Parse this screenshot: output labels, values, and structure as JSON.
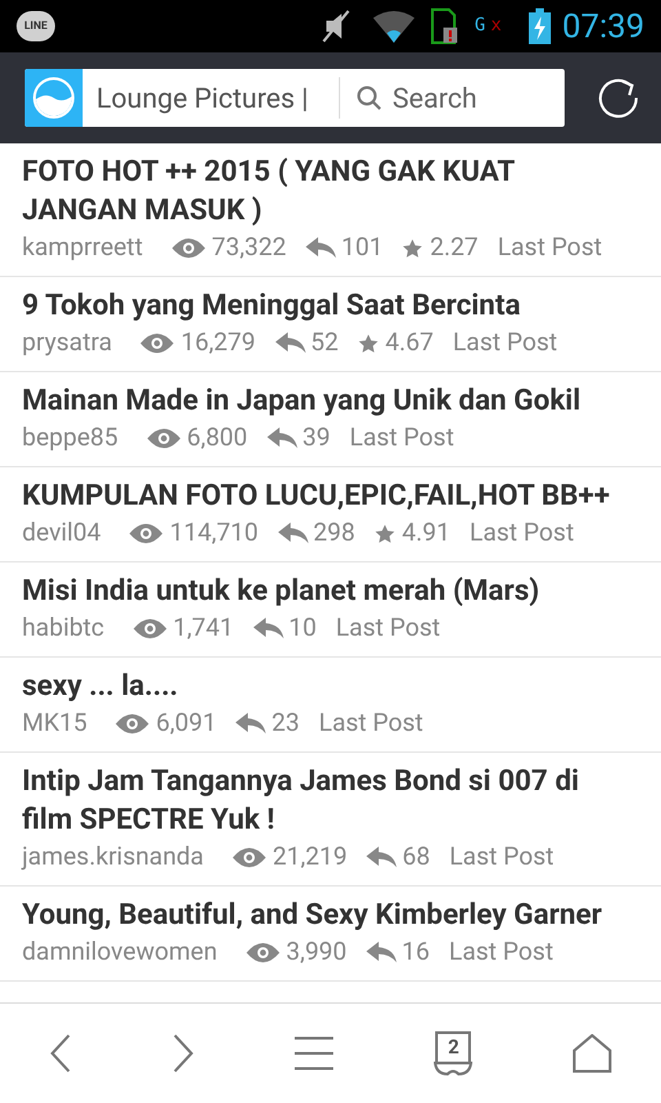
{
  "status_bar": {
    "app_badge": "LINE",
    "network": "G",
    "network_error": "x",
    "time": "07:39"
  },
  "address_bar": {
    "url": "Lounge Pictures |",
    "search_placeholder": "Search"
  },
  "threads": [
    {
      "title": "FOTO HOT ++ 2015 ( YANG GAK KUAT JANGAN MASUK )",
      "author": "kamprreett",
      "views": "73,322",
      "replies": "101",
      "rating": "2.27",
      "last_post": "Last Post"
    },
    {
      "title": "9 Tokoh yang Meninggal Saat Bercinta",
      "author": "prysatra",
      "views": "16,279",
      "replies": "52",
      "rating": "4.67",
      "last_post": "Last Post"
    },
    {
      "title": "Mainan Made in Japan yang Unik dan Gokil",
      "author": "beppe85",
      "views": "6,800",
      "replies": "39",
      "last_post": "Last Post"
    },
    {
      "title": "KUMPULAN FOTO LUCU,EPIC,FAIL,HOT BB++",
      "author": "devil04",
      "views": "114,710",
      "replies": "298",
      "rating": "4.91",
      "last_post": "Last Post"
    },
    {
      "title": "Misi India untuk ke planet merah (Mars)",
      "author": "habibtc",
      "views": "1,741",
      "replies": "10",
      "last_post": "Last Post"
    },
    {
      "title": "sexy ... la....",
      "author": "MK15",
      "views": "6,091",
      "replies": "23",
      "last_post": "Last Post"
    },
    {
      "title": "Intip Jam Tangannya James Bond si 007 di film SPECTRE Yuk !",
      "author": "james.krisnanda",
      "views": "21,219",
      "replies": "68",
      "last_post": "Last Post"
    },
    {
      "title": "Young, Beautiful, and Sexy Kimberley Garner",
      "author": "damnilovewomen",
      "views": "3,990",
      "replies": "16",
      "last_post": "Last Post"
    }
  ],
  "bottom_nav": {
    "tab_count": "2"
  }
}
